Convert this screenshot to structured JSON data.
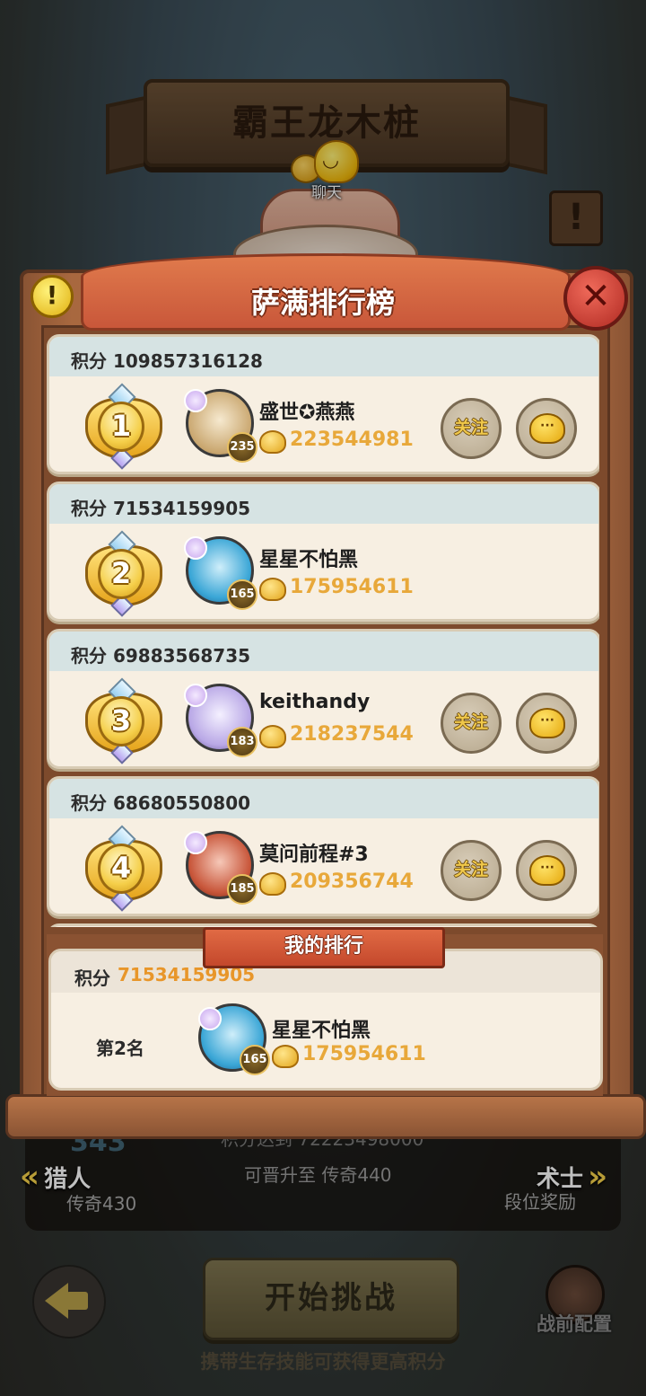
{
  "background": {
    "stage_title": "霸王龙木桩",
    "chat_label": "聊天",
    "exclaim_mark": "!",
    "left_nav": {
      "label": "猎人",
      "sub": "传奇430",
      "badge_num": "343"
    },
    "right_nav": {
      "label": "术士",
      "sub": "段位奖励"
    },
    "progress_line1": "积分达到 72223498000",
    "progress_line2": "可晋升至 传奇440",
    "start_button": "开始挑战",
    "prebattle_label": "战前配置",
    "hint": "携带生存技能可获得更高积分"
  },
  "modal": {
    "title": "萨满排行榜",
    "info_icon": "!",
    "close_icon": "✕",
    "score_prefix": "积分",
    "follow_label": "关注",
    "message_icon": "···",
    "entries": [
      {
        "rank": "1",
        "score": "109857316128",
        "name": "盛世✪燕燕",
        "level": "235",
        "gold": "223544981",
        "avatar_color": "#e8d8c0",
        "show_actions": true
      },
      {
        "rank": "2",
        "score": "71534159905",
        "name": "星星不怕黑",
        "level": "165",
        "gold": "175954611",
        "avatar_color": "#3aa6d6",
        "show_actions": false
      },
      {
        "rank": "3",
        "score": "69883568735",
        "name": "keithandy",
        "level": "183",
        "gold": "218237544",
        "avatar_color": "#b9a8e6",
        "show_actions": true
      },
      {
        "rank": "4",
        "score": "68680550800",
        "name": "莫问前程#3",
        "level": "185",
        "gold": "209356744",
        "avatar_color": "#c8563a",
        "show_actions": true
      }
    ],
    "my_rank": {
      "title": "我的排行",
      "score": "71534159905",
      "position": "第2名",
      "name": "星星不怕黑",
      "level": "165",
      "gold": "175954611",
      "avatar_color": "#3aa6d6"
    }
  }
}
